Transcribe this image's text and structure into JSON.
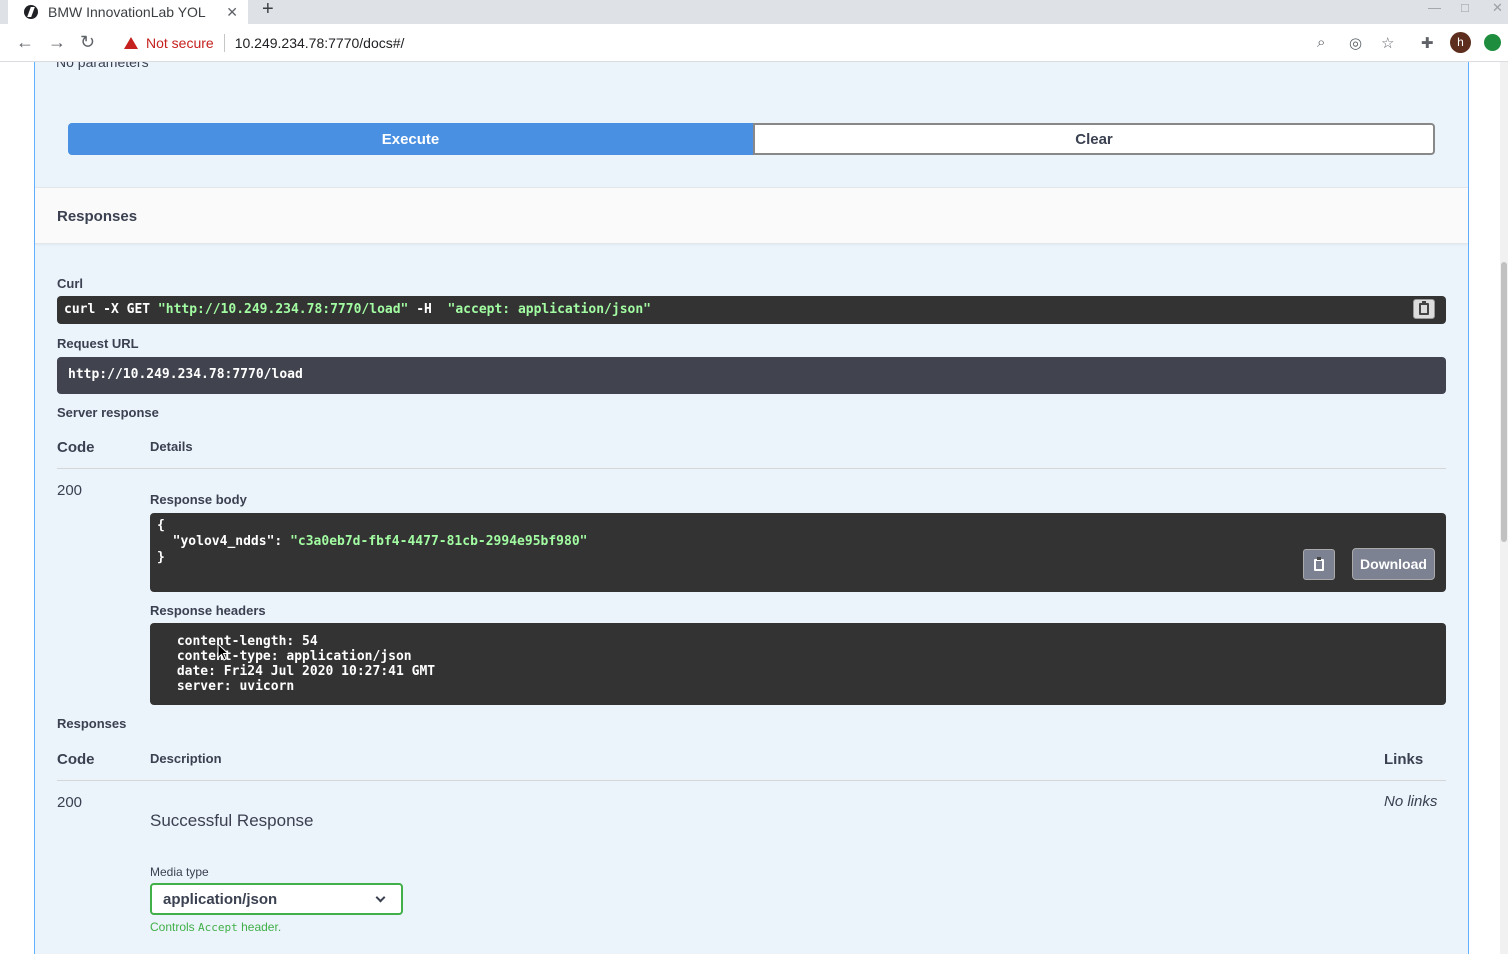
{
  "browser": {
    "tab_title": "BMW InnovationLab YOL",
    "not_secure": "Not secure",
    "url": "10.249.234.78:7770/docs#/",
    "profile_initial": "h"
  },
  "page": {
    "no_parameters": "No parameters",
    "execute_label": "Execute",
    "clear_label": "Clear",
    "responses_title": "Responses",
    "curl_label": "Curl",
    "curl_cmd_prefix": "curl -X GET ",
    "curl_url": "\"http://10.249.234.78:7770/load\"",
    "curl_h": " -H  ",
    "curl_header": "\"accept: application/json\"",
    "request_url_label": "Request URL",
    "request_url": "http://10.249.234.78:7770/load",
    "server_response_label": "Server response",
    "col_code": "Code",
    "col_details": "Details",
    "status_code": "200",
    "response_body_label": "Response body",
    "body_open": "{",
    "body_key": "  \"yolov4_ndds\": ",
    "body_value": "\"c3a0eb7d-fbf4-4477-81cb-2994e95bf980\"",
    "body_close": "}",
    "download_label": "Download",
    "response_headers_label": "Response headers",
    "response_headers": " content-length: 54 \n content-type: application/json \n date: Fri24 Jul 2020 10:27:41 GMT \n server: uvicorn ",
    "responses_label": "Responses",
    "col_description": "Description",
    "col_links": "Links",
    "resp_code": "200",
    "resp_description": "Successful Response",
    "no_links": "No links",
    "media_type_label": "Media type",
    "media_type_value": "application/json",
    "controls_prefix": "Controls ",
    "controls_code": "Accept",
    "controls_suffix": " header."
  },
  "colors": {
    "execute_blue": "#4990e2",
    "block_border": "#61affe",
    "block_bg": "#ebf3fb",
    "code_bg": "#333333",
    "string_green": "#a2fca2",
    "select_green": "#41b048"
  }
}
